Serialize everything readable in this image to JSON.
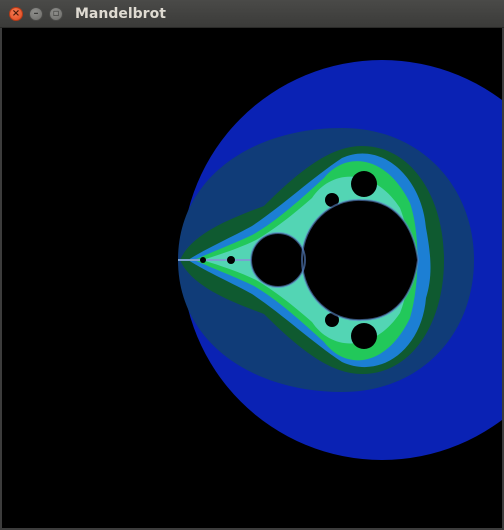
{
  "window": {
    "title": "Mandelbrot",
    "close_glyph": "×",
    "minimize_glyph": "–",
    "maximize_glyph": "▫"
  },
  "render": {
    "fractal": "Mandelbrot set",
    "colors": {
      "interior": "#000000",
      "band_outer": "#0a22b4",
      "band_2": "#103c78",
      "band_3": "#0f5a30",
      "band_4": "#1c7fd4",
      "band_5": "#22c85a",
      "band_6": "#7be0ff",
      "filament": "#7aa0d0"
    }
  }
}
